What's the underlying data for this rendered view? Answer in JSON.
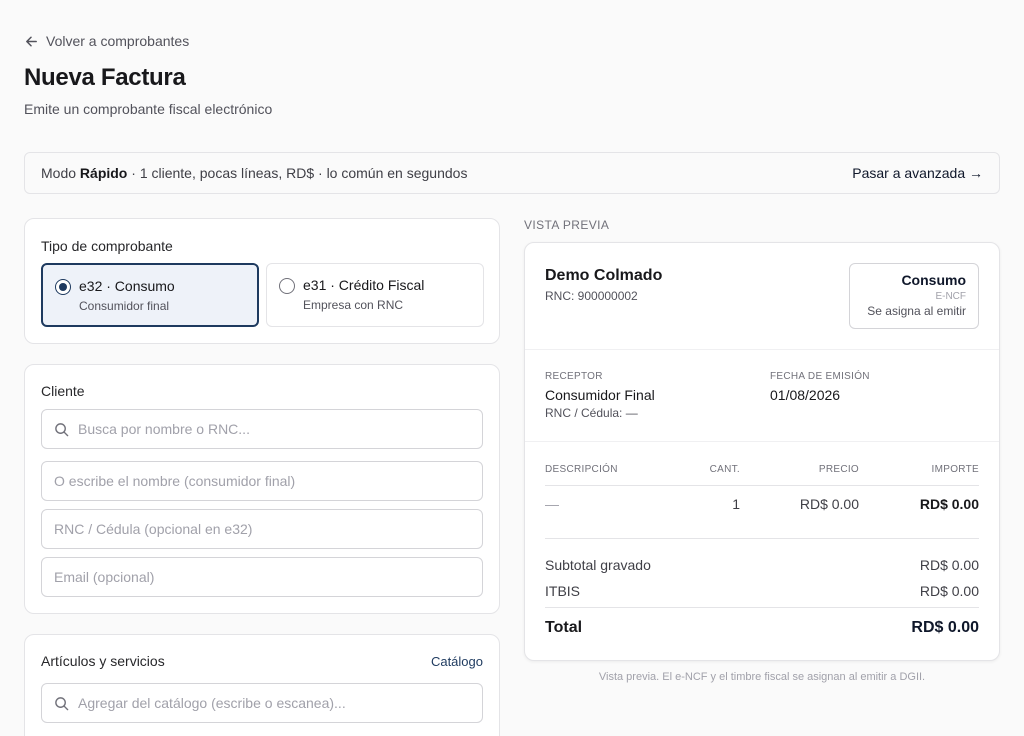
{
  "nav": {
    "back_label": "Volver a comprobantes"
  },
  "header": {
    "title": "Nueva Factura",
    "subtitle": "Emite un comprobante fiscal electrónico"
  },
  "mode_bar": {
    "prefix": "Modo ",
    "mode": "Rápido",
    "description": " · 1 cliente, pocas líneas, RD$ · lo común en segundos",
    "switch_label": "Pasar a avanzada →"
  },
  "tipo": {
    "label": "Tipo de comprobante",
    "options": [
      {
        "name": "e32 · Consumo",
        "desc": "Consumidor final",
        "selected": true
      },
      {
        "name": "e31 · Crédito Fiscal",
        "desc": "Empresa con RNC",
        "selected": false
      }
    ]
  },
  "cliente": {
    "label": "Cliente",
    "search_placeholder": "Busca por nombre o RNC...",
    "name_placeholder": "O escribe el nombre (consumidor final)",
    "rnc_placeholder": "RNC / Cédula (opcional en e32)",
    "email_placeholder": "Email (opcional)"
  },
  "articulos": {
    "label": "Artículos y servicios",
    "catalog_link": "Catálogo",
    "search_placeholder": "Agregar del catálogo (escribe o escanea)..."
  },
  "preview": {
    "section_label": "VISTA PREVIA",
    "business_name": "Demo Colmado",
    "business_rnc": "RNC: 900000002",
    "badge": {
      "type": "Consumo",
      "ncf_label": "E-NCF",
      "ncf_value": "Se asigna al emitir"
    },
    "receptor_label": "RECEPTOR",
    "receptor_name": "Consumidor Final",
    "receptor_id": "RNC / Cédula: —",
    "date_label": "FECHA DE EMISIÓN",
    "date_value": "01/08/2026",
    "columns": {
      "desc": "DESCRIPCIÓN",
      "qty": "CANT.",
      "price": "PRECIO",
      "amount": "IMPORTE"
    },
    "line": {
      "desc": "—",
      "qty": "1",
      "price": "RD$ 0.00",
      "amount": "RD$ 0.00"
    },
    "subtotal_label": "Subtotal gravado",
    "subtotal_value": "RD$ 0.00",
    "itbis_label": "ITBIS",
    "itbis_value": "RD$ 0.00",
    "total_label": "Total",
    "total_value": "RD$ 0.00",
    "footnote": "Vista previa. El e-NCF y el timbre fiscal se asignan al emitir a DGII."
  },
  "colors": {
    "accent": "#1e3a5f",
    "selected_bg": "#eef2f9"
  },
  "icons": {
    "back": "arrow-left-icon",
    "search": "search-icon"
  }
}
